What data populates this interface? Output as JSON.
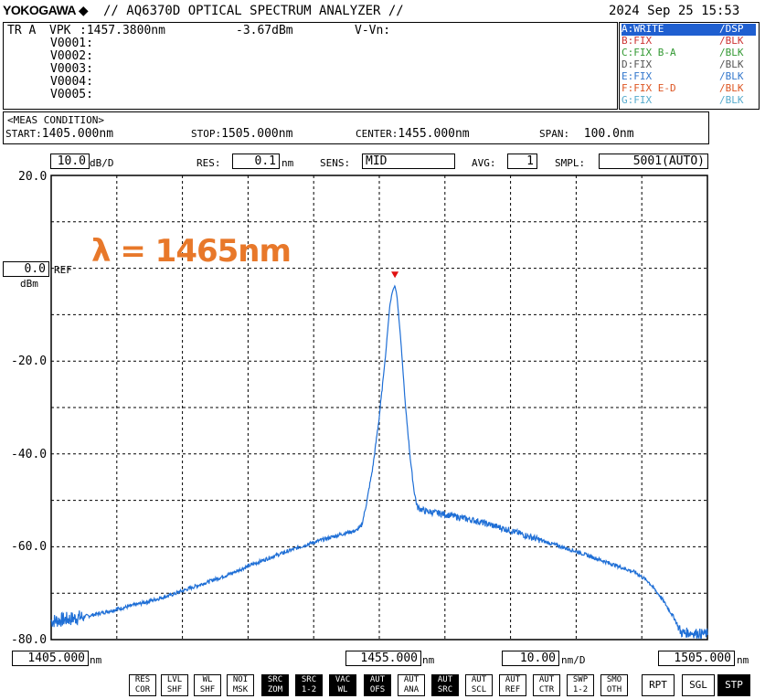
{
  "header": {
    "brand": "YOKOGAWA",
    "title": "// AQ6370D OPTICAL SPECTRUM ANALYZER //",
    "datetime": "2024 Sep 25 15:53"
  },
  "marker_panel": {
    "trace": "TR A",
    "vpk_label": "VPK",
    "vpk_wavelength": ":1457.3800nm",
    "vpk_level": "-3.67dBm",
    "delta_label": "V-Vn:",
    "markers": [
      "V0001:",
      "V0002:",
      "V0003:",
      "V0004:",
      "V0005:"
    ]
  },
  "traces": [
    {
      "label": "A:WRITE",
      "mode": "/DSP",
      "color": "#2255cc",
      "active": true
    },
    {
      "label": "B:FIX",
      "mode": "/BLK",
      "color": "#cc3333"
    },
    {
      "label": "C:FIX B-A",
      "mode": "/BLK",
      "color": "#339933"
    },
    {
      "label": "D:FIX",
      "mode": "/BLK",
      "color": "#555555"
    },
    {
      "label": "E:FIX",
      "mode": "/BLK",
      "color": "#3377cc"
    },
    {
      "label": "F:FIX E-D",
      "mode": "/BLK",
      "color": "#dd5522"
    },
    {
      "label": "G:FIX",
      "mode": "/BLK",
      "color": "#55aacc"
    }
  ],
  "meas_condition": {
    "title": "<MEAS CONDITION>",
    "start_label": "START:",
    "start": "1405.000nm",
    "stop_label": "STOP:",
    "stop": "1505.000nm",
    "center_label": "CENTER:",
    "center": "1455.000nm",
    "span_label": "SPAN:",
    "span": "100.0nm"
  },
  "settings": {
    "scale": "10.0",
    "scale_unit": "dB/D",
    "res_label": "RES:",
    "res": "0.1",
    "res_unit": "nm",
    "sens_label": "SENS:",
    "sens": "MID",
    "avg_label": "AVG:",
    "avg": "1",
    "smpl_label": "SMPL:",
    "smpl": "5001(AUTO)"
  },
  "ref": {
    "value": "0.0",
    "label": "REF",
    "unit": "dBm"
  },
  "bottom": {
    "start": "1405.000",
    "start_unit": "nm",
    "center": "1455.000",
    "center_unit": "nm",
    "div": "10.00",
    "div_unit": "nm/D",
    "stop": "1505.000",
    "stop_unit": "nm"
  },
  "annotation": "λ = 1465nm",
  "softkeys": [
    {
      "label": "RES\nCOR"
    },
    {
      "label": "LVL\nSHF"
    },
    {
      "label": "WL\nSHF"
    },
    {
      "label": "NOI\nMSK"
    },
    {
      "label": "SRC\nZOM",
      "hl": true
    },
    {
      "label": "SRC\n1-2",
      "hl": true
    },
    {
      "label": "VAC\nWL",
      "hl": true
    },
    {
      "label": "AUT\nOFS",
      "hl": true
    },
    {
      "label": "AUT\nANA"
    },
    {
      "label": "AUT\nSRC",
      "hl": true
    },
    {
      "label": "AUT\nSCL"
    },
    {
      "label": "AUT\nREF"
    },
    {
      "label": "AUT\nCTR"
    },
    {
      "label": "SWP\n1-2"
    },
    {
      "label": "SMO\nOTH"
    },
    {
      "label": "RPT",
      "big": true
    },
    {
      "label": "SGL",
      "big": true
    },
    {
      "label": "STP",
      "big": true,
      "hl": true
    }
  ],
  "chart_data": {
    "type": "line",
    "xlim": [
      1405,
      1505
    ],
    "ylim": [
      -80,
      20
    ],
    "y_ticks": [
      "20.0",
      "0.0",
      "-20.0",
      "-40.0",
      "-60.0",
      "-80.0"
    ],
    "grid": true,
    "peak": {
      "x": 1457.38,
      "y": -3.67
    },
    "series": [
      {
        "color": "#1f6fd6",
        "points": [
          [
            1405,
            -76
          ],
          [
            1408,
            -75.5
          ],
          [
            1411,
            -74.8
          ],
          [
            1414,
            -73.8
          ],
          [
            1417,
            -72.8
          ],
          [
            1420,
            -71.7
          ],
          [
            1423,
            -70.5
          ],
          [
            1426,
            -69
          ],
          [
            1429,
            -67.5
          ],
          [
            1432,
            -66
          ],
          [
            1435,
            -64.2
          ],
          [
            1438,
            -62.5
          ],
          [
            1441,
            -61
          ],
          [
            1444,
            -59.5
          ],
          [
            1447,
            -58.2
          ],
          [
            1450,
            -57
          ],
          [
            1451.5,
            -56.5
          ],
          [
            1452.3,
            -55.5
          ],
          [
            1453,
            -51
          ],
          [
            1454,
            -43
          ],
          [
            1455,
            -32
          ],
          [
            1456,
            -18
          ],
          [
            1456.6,
            -8
          ],
          [
            1457.0,
            -5
          ],
          [
            1457.38,
            -3.67
          ],
          [
            1457.7,
            -6
          ],
          [
            1458.3,
            -16
          ],
          [
            1459,
            -30
          ],
          [
            1459.8,
            -42
          ],
          [
            1460.3,
            -48
          ],
          [
            1460.8,
            -51.5
          ],
          [
            1462,
            -52.3
          ],
          [
            1465,
            -53
          ],
          [
            1470,
            -54.5
          ],
          [
            1475,
            -56.5
          ],
          [
            1480,
            -58.8
          ],
          [
            1485,
            -61
          ],
          [
            1490,
            -63.5
          ],
          [
            1494,
            -65.5
          ],
          [
            1496,
            -67.5
          ],
          [
            1498,
            -71
          ],
          [
            1500,
            -75.5
          ],
          [
            1501,
            -78.5
          ],
          [
            1502,
            -78.5
          ],
          [
            1505,
            -78.8
          ]
        ]
      }
    ]
  }
}
